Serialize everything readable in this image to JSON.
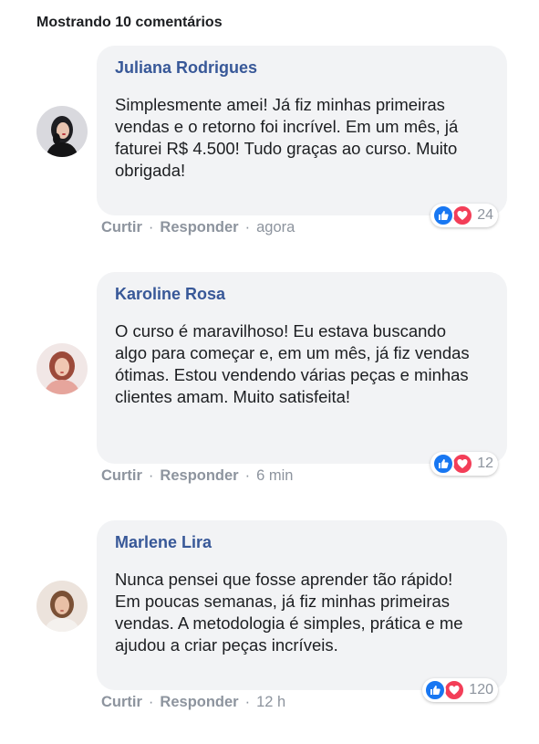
{
  "header": {
    "title": "Mostrando 10 comentários"
  },
  "colors": {
    "author": "#385898",
    "bubble": "#f2f3f5",
    "like": "#1877f2",
    "love": "#f33e58",
    "muted": "#8d949e"
  },
  "comments": [
    {
      "author": "Juliana Rodrigues",
      "text": "Simplesmente amei! Já fiz minhas primeiras vendas e o retorno foi incrível. Em um mês, já faturei R$ 4.500! Tudo graças ao curso. Muito obrigada!",
      "reaction_count": "24",
      "like_label": "Curtir",
      "reply_label": "Responder",
      "time": "agora"
    },
    {
      "author": "Karoline Rosa",
      "text": "O curso é maravilhoso! Eu estava buscando algo para começar e, em um mês, já fiz vendas ótimas. Estou vendendo várias peças e minhas clientes amam. Muito satisfeita!",
      "reaction_count": "12",
      "like_label": "Curtir",
      "reply_label": "Responder",
      "time": "6 min"
    },
    {
      "author": "Marlene Lira",
      "text": "Nunca pensei que fosse aprender tão rápido! Em poucas semanas, já fiz minhas primeiras vendas. A metodologia é simples, prática e me ajudou a criar peças incríveis.",
      "reaction_count": "120",
      "like_label": "Curtir",
      "reply_label": "Responder",
      "time": "12 h"
    }
  ]
}
